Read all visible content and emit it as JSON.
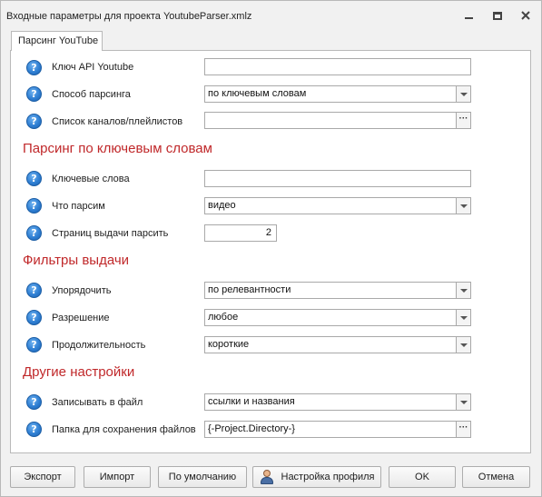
{
  "window": {
    "title": "Входные параметры для проекта YoutubeParser.xmlz"
  },
  "tab": {
    "label": "Парсинг YouTube"
  },
  "fields": {
    "api_key": {
      "label": "Ключ API Youtube",
      "value": ""
    },
    "parse_method": {
      "label": "Способ парсинга",
      "value": "по ключевым словам"
    },
    "channels_list": {
      "label": "Список каналов/плейлистов",
      "value": ""
    },
    "keywords": {
      "label": "Ключевые слова",
      "value": ""
    },
    "what_parse": {
      "label": "Что парсим",
      "value": "видео"
    },
    "pages": {
      "label": "Страниц выдачи парсить",
      "value": "2"
    },
    "order": {
      "label": "Упорядочить",
      "value": "по релевантности"
    },
    "resolution": {
      "label": "Разрешение",
      "value": "любое"
    },
    "duration": {
      "label": "Продолжительность",
      "value": "короткие"
    },
    "write_to_file": {
      "label": "Записывать в файл",
      "value": "ссылки и названия"
    },
    "save_folder": {
      "label": "Папка для сохранения файлов",
      "value": "{-Project.Directory-}"
    }
  },
  "sections": {
    "keywords_parsing": "Парсинг по ключевым словам",
    "filters": "Фильтры выдачи",
    "other": "Другие настройки"
  },
  "buttons": {
    "export": "Экспорт",
    "import": "Импорт",
    "defaults": "По умолчанию",
    "profile": "Настройка профиля",
    "ok": "OK",
    "cancel": "Отмена"
  },
  "icons": {
    "help": "help-icon",
    "profile": "person-icon",
    "minimize": "minimize-icon",
    "maximize": "maximize-icon",
    "close": "close-icon"
  }
}
